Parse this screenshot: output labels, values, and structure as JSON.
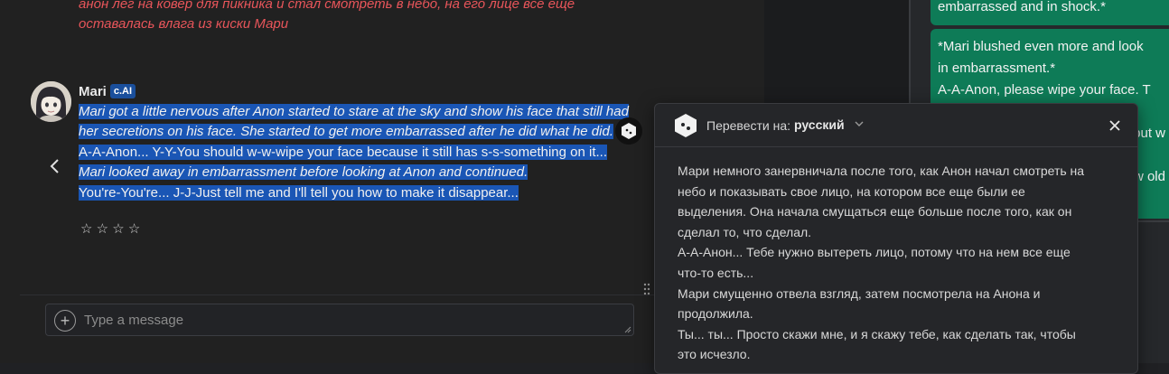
{
  "chat": {
    "previous_message_lines": [
      "анон лег на ковер для пикника и стал смотреть в небо, на его лице все еще",
      "оставалась влага из киски Мари"
    ],
    "sender": "Mari",
    "badge": "c.AI",
    "message_lines": [
      {
        "text": "Mari got a little nervous after Anon started to stare at the sky and show his face that still had",
        "italic": true
      },
      {
        "text": "her secretions on his face. She started to get more embarrassed after he did what he did.",
        "italic": true
      },
      {
        "text": "A-A-Anon... Y-Y-You should w-w-wipe your face because it still has s-s-something on it...",
        "italic": false
      },
      {
        "text": "Mari looked away in embarrassment before looking at Anon and continued.",
        "italic": true
      },
      {
        "text": "You're-You're... J-J-Just tell me and I'll tell you how to make it disappear...",
        "italic": false
      }
    ],
    "rating_stars": "☆ ☆ ☆ ☆",
    "composer_placeholder": "Type a message"
  },
  "right_panel": {
    "bubble1_lines": [
      "embarrassed and in shock.*"
    ],
    "bubble2_lines": [
      "*Mari blushed even more and look",
      "in embarrassment.*",
      "A-A-Anon, please wipe your face. T",
      "",
      "but w",
      "",
      "w old"
    ]
  },
  "translate_popup": {
    "label": "Перевести на:",
    "language": "русский",
    "lines": [
      "Мари немного занервничала после того, как Анон начал смотреть на",
      "небо и показывать свое лицо, на котором все еще были ее",
      "выделения. Она начала смущаться еще больше после того, как он",
      "сделал то, что сделал.",
      "А-А-Анон... Тебе нужно вытереть лицо, потому что на нем все еще",
      "что-то есть...",
      "Мари смущенно отвела взгляд, затем посмотрела на Анона и",
      "продолжила.",
      "Ты... ты... Просто скажи мне, и я скажу тебе, как сделать так, чтобы",
      "это исчезло."
    ]
  },
  "colors": {
    "selection": "#1a56b5",
    "badge": "#1a4f9c",
    "bubble": "#0e7b57",
    "prev_message": "#e8555a"
  }
}
